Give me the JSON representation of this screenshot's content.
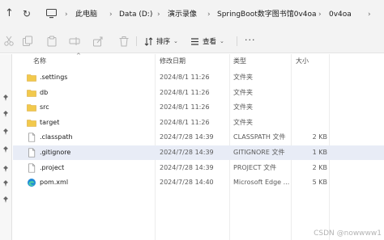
{
  "address_bar": {
    "breadcrumbs": [
      "此电脑",
      "Data (D:)",
      "演示录像",
      "SpringBoot数字图书馆0v4oa",
      "0v4oa"
    ]
  },
  "toolbar": {
    "sort_label": "排序",
    "view_label": "查看"
  },
  "columns": {
    "name": "名称",
    "modified": "修改日期",
    "type": "类型",
    "size": "大小"
  },
  "files": [
    {
      "name": ".settings",
      "modified": "2024/8/1 11:26",
      "type": "文件夹",
      "size": "",
      "icon": "folder-icon"
    },
    {
      "name": "db",
      "modified": "2024/8/1 11:26",
      "type": "文件夹",
      "size": "",
      "icon": "folder-icon"
    },
    {
      "name": "src",
      "modified": "2024/8/1 11:26",
      "type": "文件夹",
      "size": "",
      "icon": "folder-icon"
    },
    {
      "name": "target",
      "modified": "2024/8/1 11:26",
      "type": "文件夹",
      "size": "",
      "icon": "folder-icon"
    },
    {
      "name": ".classpath",
      "modified": "2024/7/28 14:39",
      "type": "CLASSPATH 文件",
      "size": "2 KB",
      "icon": "file-icon"
    },
    {
      "name": ".gitignore",
      "modified": "2024/7/28 14:39",
      "type": "GITIGNORE 文件",
      "size": "1 KB",
      "icon": "file-icon",
      "selected": true
    },
    {
      "name": ".project",
      "modified": "2024/7/28 14:39",
      "type": "PROJECT 文件",
      "size": "2 KB",
      "icon": "file-icon"
    },
    {
      "name": "pom.xml",
      "modified": "2024/7/28 14:40",
      "type": "Microsoft Edge ...",
      "size": "5 KB",
      "icon": "edge-icon"
    }
  ],
  "watermark": "CSDN @nowwww1",
  "colors": {
    "folder": "#f2c94c",
    "selection": "#e8ecf6",
    "chrome": "#f3f3f3"
  }
}
